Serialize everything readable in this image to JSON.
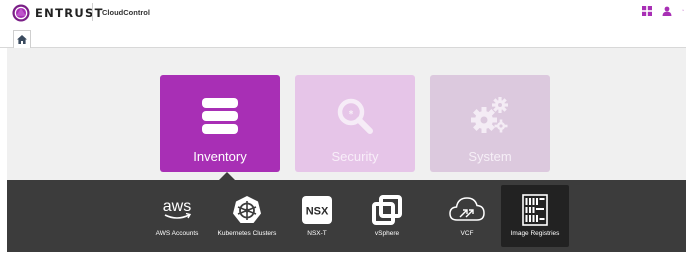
{
  "header": {
    "brand": "ENTRUST",
    "product": "CloudControl",
    "icons": [
      "grid-icon",
      "user-icon",
      "bell-icon"
    ]
  },
  "tabs": [
    {
      "icon": "home-icon"
    }
  ],
  "tiles": [
    {
      "label": "Inventory",
      "icon": "database-icon",
      "state": "active",
      "color": "#a82fb5"
    },
    {
      "label": "Security",
      "icon": "search-icon",
      "state": "inactive",
      "color": "#e6c5e8"
    },
    {
      "label": "System",
      "icon": "gears-icon",
      "state": "inactive",
      "color": "#dcc9de"
    }
  ],
  "subnav": [
    {
      "label": "AWS Accounts",
      "icon": "aws-icon"
    },
    {
      "label": "Kubernetes Clusters",
      "icon": "kubernetes-icon"
    },
    {
      "label": "NSX-T",
      "icon": "nsx-icon",
      "badge": "NSX"
    },
    {
      "label": "vSphere",
      "icon": "vsphere-icon"
    },
    {
      "label": "VCF",
      "icon": "cloud-icon"
    },
    {
      "label": "Image Registries",
      "icon": "registry-icon",
      "active": true
    }
  ],
  "colors": {
    "accent": "#a82fb5",
    "subbar": "#3c3c3c",
    "main_bg": "#f0f0f0"
  }
}
